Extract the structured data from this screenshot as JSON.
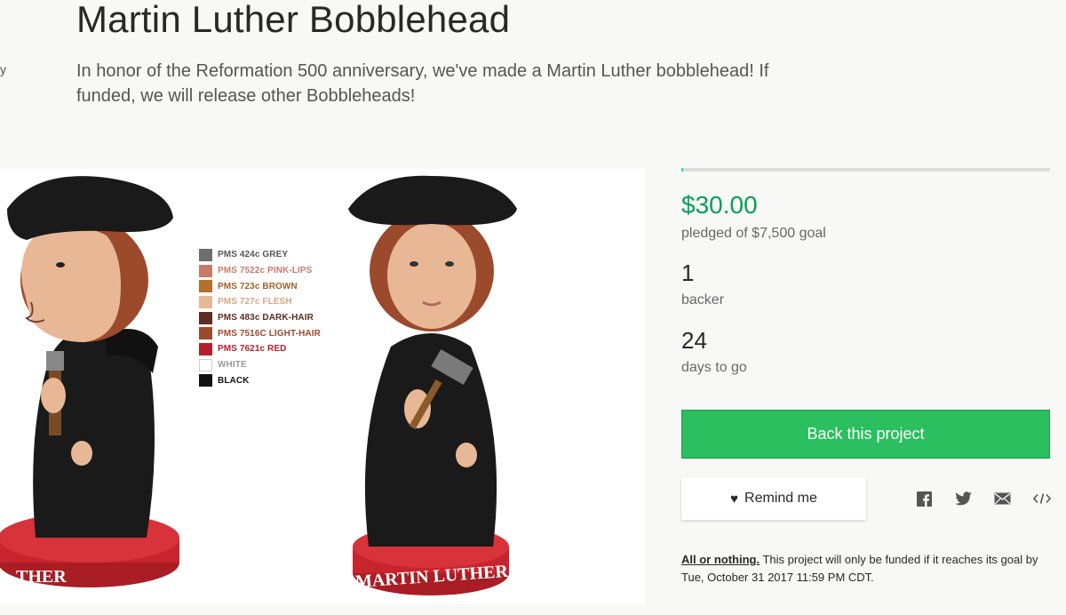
{
  "page": {
    "edge_char": "y",
    "title": "Martin Luther Bobblehead",
    "blurb": "In honor of the Reformation 500 anniversary, we've made a Martin Luther bobblehead! If funded, we will release other Bobbleheads!"
  },
  "media": {
    "base_text_left": "THER",
    "base_text_right": "MARTIN LUTHER",
    "swatches": [
      {
        "label": "PMS 424c GREY",
        "color": "#6d6e71",
        "text_color": "#555555"
      },
      {
        "label": "PMS 7522c PINK-LIPS",
        "color": "#c97b6a",
        "text_color": "#c97b6a"
      },
      {
        "label": "PMS 723c BROWN",
        "color": "#b4702e",
        "text_color": "#a0622a"
      },
      {
        "label": "PMS 727c FLESH",
        "color": "#e8b896",
        "text_color": "#dba585"
      },
      {
        "label": "PMS 483c DARK-HAIR",
        "color": "#5b2c1f",
        "text_color": "#5b2c1f"
      },
      {
        "label": "PMS 7516C LIGHT-HAIR",
        "color": "#9b4a2c",
        "text_color": "#9b4a2c"
      },
      {
        "label": "PMS 7621c RED",
        "color": "#b3202a",
        "text_color": "#b3202a"
      },
      {
        "label": "WHITE",
        "color": "#ffffff",
        "text_color": "#9a9a9a"
      },
      {
        "label": "BLACK",
        "color": "#111111",
        "text_color": "#111111"
      }
    ]
  },
  "stats": {
    "progress_fraction": 0.004,
    "pledged_amount": "$30.00",
    "pledged_sub": "pledged of $7,500 goal",
    "backers_count": "1",
    "backers_label": "backer",
    "days_count": "24",
    "days_label": "days to go"
  },
  "actions": {
    "back_label": "Back this project",
    "remind_label": "Remind me",
    "share_icons": [
      "facebook-icon",
      "twitter-icon",
      "email-icon",
      "embed-icon"
    ]
  },
  "footnote": {
    "underline": "All or nothing.",
    "text": " This project will only be funded if it reaches its goal by Tue, October 31 2017 11:59 PM CDT."
  },
  "colors": {
    "accent_green": "#2bbf5f",
    "pledged_green": "#05a05a",
    "progress_green": "#2bde73"
  }
}
